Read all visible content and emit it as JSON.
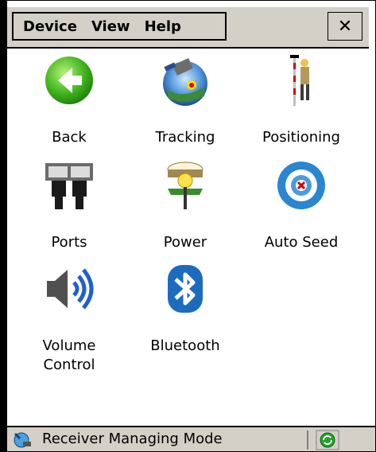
{
  "menu": {
    "items": [
      "Device",
      "View",
      "Help"
    ],
    "close_label": "✕"
  },
  "apps": [
    {
      "label": "Back",
      "icon": "back-arrow-icon"
    },
    {
      "label": "Tracking",
      "icon": "satellite-tracking-icon"
    },
    {
      "label": "Positioning",
      "icon": "surveyor-pole-icon"
    },
    {
      "label": "Ports",
      "icon": "ports-connectors-icon"
    },
    {
      "label": "Power",
      "icon": "receiver-power-icon"
    },
    {
      "label": "Auto Seed",
      "icon": "target-icon"
    },
    {
      "label": "Volume\nControl",
      "icon": "speaker-volume-icon"
    },
    {
      "label": "Bluetooth",
      "icon": "bluetooth-icon"
    }
  ],
  "status": {
    "text": "Receiver Managing Mode",
    "left_icon": "receiver-status-icon",
    "right_icon": "sync-green-icon"
  }
}
